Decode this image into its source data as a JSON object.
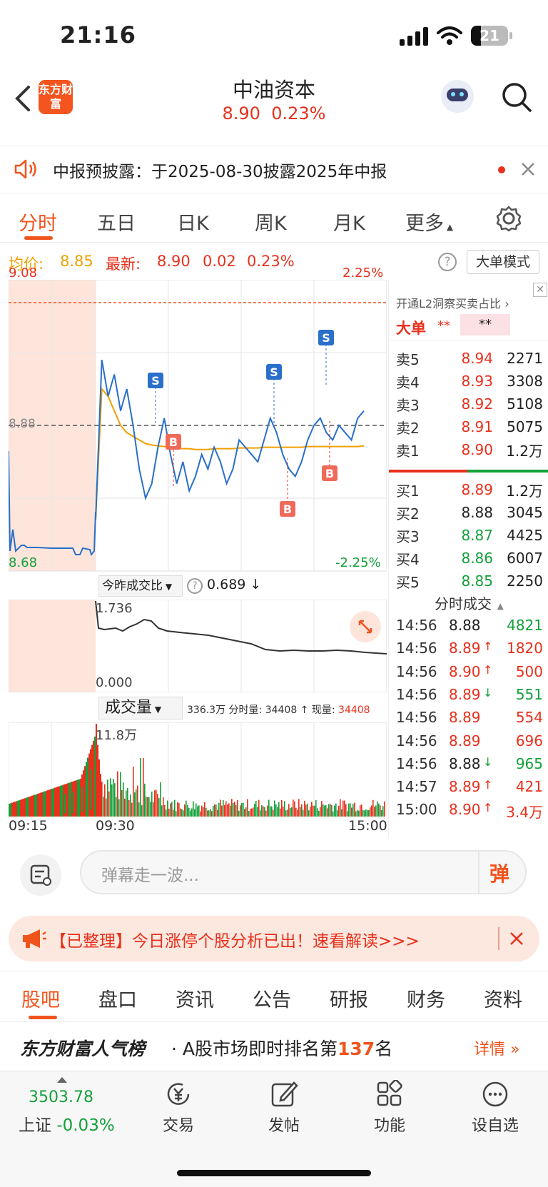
{
  "status_bar": {
    "time": "21:16",
    "battery": "21"
  },
  "header": {
    "logo_text": "东方财富",
    "title": "中油资本",
    "price": "8.90",
    "change_pct": "0.23%"
  },
  "notice": {
    "text": "中报预披露：于2025-08-30披露2025年中报"
  },
  "chart_tabs": [
    "分时",
    "五日",
    "日K",
    "周K",
    "月K",
    "更多"
  ],
  "info": {
    "avg_label": "均价:",
    "avg_value": "8.85",
    "latest_label": "最新:",
    "latest_price": "8.90",
    "change": "0.02",
    "change_pct": "0.23%",
    "mode_button": "大单模式"
  },
  "chart_labels": {
    "high_price": "9.08",
    "low_price": "8.68",
    "ref_price": "8.88",
    "high_pct": "2.25%",
    "low_pct": "-2.25%",
    "ratio_selector": "今昨成交比",
    "ratio_value": "0.689 ↓",
    "ratio_top": "1.736",
    "ratio_bottom": "0.000",
    "volume_selector": "成交量",
    "volume_info": "336.3万 分时量: 34408 ↑ 现量:",
    "volume_now": "34408",
    "volume_max": "11.8万",
    "time_start": "09:15",
    "time_open": "09:30",
    "time_end": "15:00"
  },
  "chart_data": {
    "type": "line",
    "xlabel": "",
    "ylabel": "",
    "ylim": [
      8.68,
      9.08
    ],
    "ref_price": 8.88,
    "series": [
      {
        "name": "",
        "color": "#2a6fc9",
        "values": [
          8.75,
          8.97,
          8.92,
          8.95,
          8.9,
          8.93,
          8.88,
          8.82,
          8.78,
          8.8,
          8.85,
          8.89,
          8.84,
          8.8,
          8.83,
          8.79,
          8.81,
          8.84,
          8.82,
          8.85,
          8.83,
          8.8,
          8.82,
          8.86,
          8.85,
          8.84,
          8.83,
          8.86,
          8.89,
          8.87,
          8.84,
          8.82,
          8.81,
          8.83,
          8.86,
          8.88,
          8.89,
          8.87,
          8.86,
          8.88,
          8.87,
          8.86,
          8.89,
          8.9
        ]
      },
      {
        "name": "",
        "color": "#f0a000",
        "values": [
          8.75,
          8.93,
          8.92,
          8.9,
          8.88,
          8.87,
          8.865,
          8.86,
          8.855,
          8.853,
          8.852,
          8.851,
          8.85,
          8.849,
          8.848,
          8.848,
          8.847,
          8.847,
          8.847,
          8.848,
          8.848,
          8.848,
          8.848,
          8.849,
          8.849,
          8.849,
          8.849,
          8.85,
          8.85,
          8.85,
          8.85,
          8.85,
          8.85,
          8.85,
          8.851,
          8.851,
          8.851,
          8.851,
          8.851,
          8.851,
          8.851,
          8.851,
          8.851,
          8.852
        ]
      }
    ]
  },
  "order_book": {
    "l2_text": "开通L2洞察买卖占比",
    "big_label": "大单",
    "big_value_1": "**",
    "big_value_2": "**",
    "asks": [
      {
        "label": "卖5",
        "price": "8.94",
        "vol": "2271"
      },
      {
        "label": "卖4",
        "price": "8.93",
        "vol": "3308"
      },
      {
        "label": "卖3",
        "price": "8.92",
        "vol": "5108"
      },
      {
        "label": "卖2",
        "price": "8.91",
        "vol": "5075"
      },
      {
        "label": "卖1",
        "price": "8.90",
        "vol": "1.2万"
      }
    ],
    "bids": [
      {
        "label": "买1",
        "price": "8.89",
        "vol": "1.2万"
      },
      {
        "label": "买2",
        "price": "8.88",
        "vol": "3045"
      },
      {
        "label": "买3",
        "price": "8.87",
        "vol": "4425"
      },
      {
        "label": "买4",
        "price": "8.86",
        "vol": "6007"
      },
      {
        "label": "买5",
        "price": "8.85",
        "vol": "2250"
      }
    ]
  },
  "trades": {
    "title": "分时成交",
    "rows": [
      {
        "time": "14:56",
        "price": "8.88",
        "arrow": "",
        "vol": "4821"
      },
      {
        "time": "14:56",
        "price": "8.89",
        "arrow": "↑",
        "vol": "1820"
      },
      {
        "time": "14:56",
        "price": "8.90",
        "arrow": "↑",
        "vol": "500"
      },
      {
        "time": "14:56",
        "price": "8.89",
        "arrow": "↓",
        "vol": "551"
      },
      {
        "time": "14:56",
        "price": "8.89",
        "arrow": "",
        "vol": "554"
      },
      {
        "time": "14:56",
        "price": "8.89",
        "arrow": "",
        "vol": "696"
      },
      {
        "time": "14:56",
        "price": "8.88",
        "arrow": "↓",
        "vol": "965"
      },
      {
        "time": "14:57",
        "price": "8.89",
        "arrow": "↑",
        "vol": "421"
      },
      {
        "time": "15:00",
        "price": "8.90",
        "arrow": "↑",
        "vol": "3.4万"
      }
    ]
  },
  "danmu": {
    "placeholder": "弹幕走一波...",
    "button": "弹"
  },
  "banner": {
    "text": "【已整理】今日涨停个股分析已出！速看解读>>>"
  },
  "bottom_tabs": [
    "股吧",
    "盘口",
    "资讯",
    "公告",
    "研报",
    "财务",
    "资料"
  ],
  "rank": {
    "brand": "东方财富人气榜",
    "text": "· A股市场即时排名第",
    "number": "137",
    "suffix": "名",
    "details": "详情"
  },
  "bottom_nav": {
    "index_value": "3503.78",
    "index_name": "上证",
    "index_change": "-0.03%",
    "items": [
      "交易",
      "发帖",
      "功能",
      "设自选"
    ]
  }
}
